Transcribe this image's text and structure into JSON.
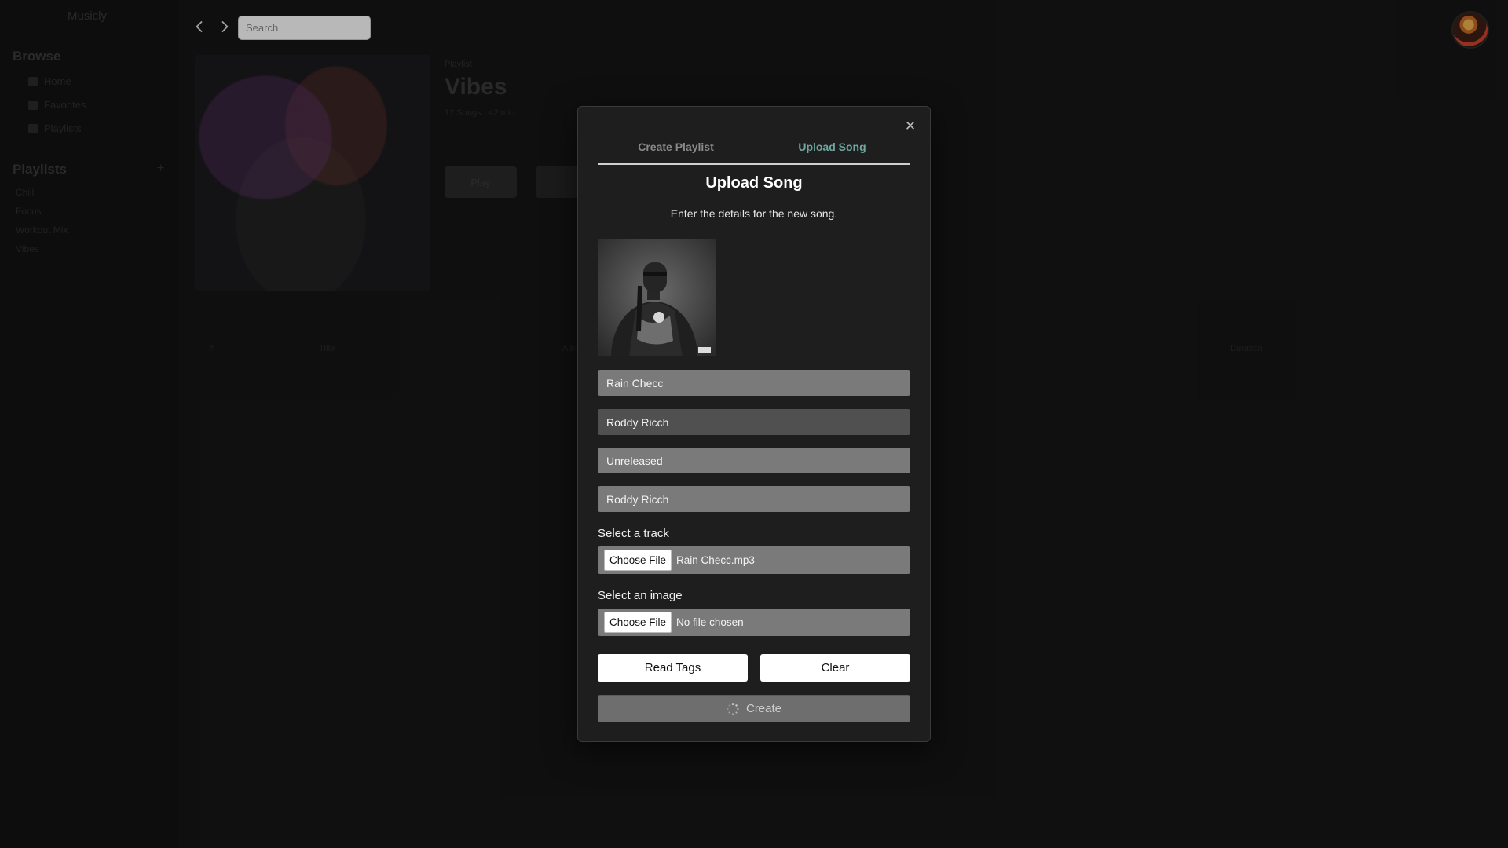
{
  "app": {
    "title": "Musicly",
    "search": {
      "placeholder": "Search",
      "value": ""
    }
  },
  "sidebar": {
    "browse_title": "Browse",
    "browse_items": [
      {
        "label": "Home",
        "icon": "home-icon"
      },
      {
        "label": "Favorites",
        "icon": "heart-icon"
      },
      {
        "label": "Playlists",
        "icon": "list-icon"
      }
    ],
    "playlists_title": "Playlists",
    "playlists": [
      "Chill",
      "Focus",
      "Workout Mix",
      "Vibes"
    ]
  },
  "background_playlist": {
    "type_label": "Playlist",
    "title": "Vibes",
    "meta": "12 Songs · 42 min",
    "play_label": "Play",
    "columns": [
      "#",
      "Title",
      "Album",
      "Duration"
    ]
  },
  "modal": {
    "tabs": [
      {
        "label": "Create Playlist",
        "active": false
      },
      {
        "label": "Upload Song",
        "active": true
      }
    ],
    "title": "Upload Song",
    "subtitle": "Enter the details for the new song.",
    "fields": {
      "title": "Rain Checc",
      "artist": "Roddy Ricch",
      "album": "Unreleased",
      "album_artist": "Roddy Ricch"
    },
    "track_label": "Select a track",
    "track_button": "Choose File",
    "track_file": "Rain Checc.mp3",
    "image_label": "Select an image",
    "image_button": "Choose File",
    "image_file": "No file chosen",
    "read_tags_label": "Read Tags",
    "clear_label": "Clear",
    "create_label": "Create",
    "colors": {
      "active_tab": "#6fa6a0",
      "create_disabled": "#6e6e6e"
    }
  }
}
